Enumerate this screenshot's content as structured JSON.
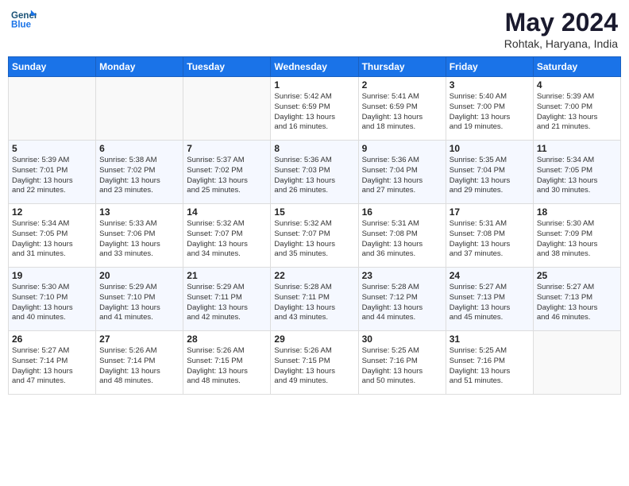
{
  "header": {
    "logo_line1": "General",
    "logo_line2": "Blue",
    "month": "May 2024",
    "location": "Rohtak, Haryana, India"
  },
  "weekdays": [
    "Sunday",
    "Monday",
    "Tuesday",
    "Wednesday",
    "Thursday",
    "Friday",
    "Saturday"
  ],
  "weeks": [
    [
      {
        "day": "",
        "info": ""
      },
      {
        "day": "",
        "info": ""
      },
      {
        "day": "",
        "info": ""
      },
      {
        "day": "1",
        "info": "Sunrise: 5:42 AM\nSunset: 6:59 PM\nDaylight: 13 hours\nand 16 minutes."
      },
      {
        "day": "2",
        "info": "Sunrise: 5:41 AM\nSunset: 6:59 PM\nDaylight: 13 hours\nand 18 minutes."
      },
      {
        "day": "3",
        "info": "Sunrise: 5:40 AM\nSunset: 7:00 PM\nDaylight: 13 hours\nand 19 minutes."
      },
      {
        "day": "4",
        "info": "Sunrise: 5:39 AM\nSunset: 7:00 PM\nDaylight: 13 hours\nand 21 minutes."
      }
    ],
    [
      {
        "day": "5",
        "info": "Sunrise: 5:39 AM\nSunset: 7:01 PM\nDaylight: 13 hours\nand 22 minutes."
      },
      {
        "day": "6",
        "info": "Sunrise: 5:38 AM\nSunset: 7:02 PM\nDaylight: 13 hours\nand 23 minutes."
      },
      {
        "day": "7",
        "info": "Sunrise: 5:37 AM\nSunset: 7:02 PM\nDaylight: 13 hours\nand 25 minutes."
      },
      {
        "day": "8",
        "info": "Sunrise: 5:36 AM\nSunset: 7:03 PM\nDaylight: 13 hours\nand 26 minutes."
      },
      {
        "day": "9",
        "info": "Sunrise: 5:36 AM\nSunset: 7:04 PM\nDaylight: 13 hours\nand 27 minutes."
      },
      {
        "day": "10",
        "info": "Sunrise: 5:35 AM\nSunset: 7:04 PM\nDaylight: 13 hours\nand 29 minutes."
      },
      {
        "day": "11",
        "info": "Sunrise: 5:34 AM\nSunset: 7:05 PM\nDaylight: 13 hours\nand 30 minutes."
      }
    ],
    [
      {
        "day": "12",
        "info": "Sunrise: 5:34 AM\nSunset: 7:05 PM\nDaylight: 13 hours\nand 31 minutes."
      },
      {
        "day": "13",
        "info": "Sunrise: 5:33 AM\nSunset: 7:06 PM\nDaylight: 13 hours\nand 33 minutes."
      },
      {
        "day": "14",
        "info": "Sunrise: 5:32 AM\nSunset: 7:07 PM\nDaylight: 13 hours\nand 34 minutes."
      },
      {
        "day": "15",
        "info": "Sunrise: 5:32 AM\nSunset: 7:07 PM\nDaylight: 13 hours\nand 35 minutes."
      },
      {
        "day": "16",
        "info": "Sunrise: 5:31 AM\nSunset: 7:08 PM\nDaylight: 13 hours\nand 36 minutes."
      },
      {
        "day": "17",
        "info": "Sunrise: 5:31 AM\nSunset: 7:08 PM\nDaylight: 13 hours\nand 37 minutes."
      },
      {
        "day": "18",
        "info": "Sunrise: 5:30 AM\nSunset: 7:09 PM\nDaylight: 13 hours\nand 38 minutes."
      }
    ],
    [
      {
        "day": "19",
        "info": "Sunrise: 5:30 AM\nSunset: 7:10 PM\nDaylight: 13 hours\nand 40 minutes."
      },
      {
        "day": "20",
        "info": "Sunrise: 5:29 AM\nSunset: 7:10 PM\nDaylight: 13 hours\nand 41 minutes."
      },
      {
        "day": "21",
        "info": "Sunrise: 5:29 AM\nSunset: 7:11 PM\nDaylight: 13 hours\nand 42 minutes."
      },
      {
        "day": "22",
        "info": "Sunrise: 5:28 AM\nSunset: 7:11 PM\nDaylight: 13 hours\nand 43 minutes."
      },
      {
        "day": "23",
        "info": "Sunrise: 5:28 AM\nSunset: 7:12 PM\nDaylight: 13 hours\nand 44 minutes."
      },
      {
        "day": "24",
        "info": "Sunrise: 5:27 AM\nSunset: 7:13 PM\nDaylight: 13 hours\nand 45 minutes."
      },
      {
        "day": "25",
        "info": "Sunrise: 5:27 AM\nSunset: 7:13 PM\nDaylight: 13 hours\nand 46 minutes."
      }
    ],
    [
      {
        "day": "26",
        "info": "Sunrise: 5:27 AM\nSunset: 7:14 PM\nDaylight: 13 hours\nand 47 minutes."
      },
      {
        "day": "27",
        "info": "Sunrise: 5:26 AM\nSunset: 7:14 PM\nDaylight: 13 hours\nand 48 minutes."
      },
      {
        "day": "28",
        "info": "Sunrise: 5:26 AM\nSunset: 7:15 PM\nDaylight: 13 hours\nand 48 minutes."
      },
      {
        "day": "29",
        "info": "Sunrise: 5:26 AM\nSunset: 7:15 PM\nDaylight: 13 hours\nand 49 minutes."
      },
      {
        "day": "30",
        "info": "Sunrise: 5:25 AM\nSunset: 7:16 PM\nDaylight: 13 hours\nand 50 minutes."
      },
      {
        "day": "31",
        "info": "Sunrise: 5:25 AM\nSunset: 7:16 PM\nDaylight: 13 hours\nand 51 minutes."
      },
      {
        "day": "",
        "info": ""
      }
    ]
  ]
}
